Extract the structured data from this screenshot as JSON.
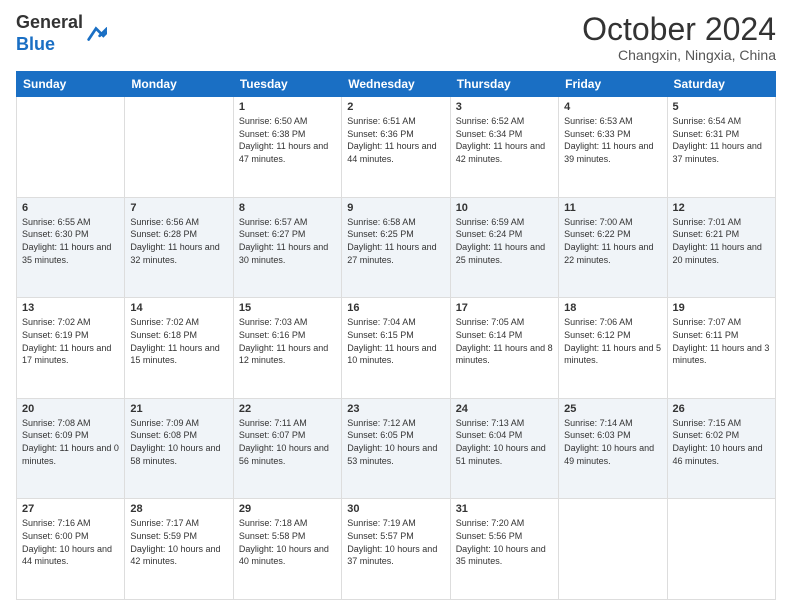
{
  "header": {
    "logo": {
      "line1": "General",
      "line2": "Blue"
    },
    "title": "October 2024",
    "location": "Changxin, Ningxia, China"
  },
  "days_of_week": [
    "Sunday",
    "Monday",
    "Tuesday",
    "Wednesday",
    "Thursday",
    "Friday",
    "Saturday"
  ],
  "weeks": [
    [
      {
        "day": "",
        "info": ""
      },
      {
        "day": "",
        "info": ""
      },
      {
        "day": "1",
        "info": "Sunrise: 6:50 AM\nSunset: 6:38 PM\nDaylight: 11 hours and 47 minutes."
      },
      {
        "day": "2",
        "info": "Sunrise: 6:51 AM\nSunset: 6:36 PM\nDaylight: 11 hours and 44 minutes."
      },
      {
        "day": "3",
        "info": "Sunrise: 6:52 AM\nSunset: 6:34 PM\nDaylight: 11 hours and 42 minutes."
      },
      {
        "day": "4",
        "info": "Sunrise: 6:53 AM\nSunset: 6:33 PM\nDaylight: 11 hours and 39 minutes."
      },
      {
        "day": "5",
        "info": "Sunrise: 6:54 AM\nSunset: 6:31 PM\nDaylight: 11 hours and 37 minutes."
      }
    ],
    [
      {
        "day": "6",
        "info": "Sunrise: 6:55 AM\nSunset: 6:30 PM\nDaylight: 11 hours and 35 minutes."
      },
      {
        "day": "7",
        "info": "Sunrise: 6:56 AM\nSunset: 6:28 PM\nDaylight: 11 hours and 32 minutes."
      },
      {
        "day": "8",
        "info": "Sunrise: 6:57 AM\nSunset: 6:27 PM\nDaylight: 11 hours and 30 minutes."
      },
      {
        "day": "9",
        "info": "Sunrise: 6:58 AM\nSunset: 6:25 PM\nDaylight: 11 hours and 27 minutes."
      },
      {
        "day": "10",
        "info": "Sunrise: 6:59 AM\nSunset: 6:24 PM\nDaylight: 11 hours and 25 minutes."
      },
      {
        "day": "11",
        "info": "Sunrise: 7:00 AM\nSunset: 6:22 PM\nDaylight: 11 hours and 22 minutes."
      },
      {
        "day": "12",
        "info": "Sunrise: 7:01 AM\nSunset: 6:21 PM\nDaylight: 11 hours and 20 minutes."
      }
    ],
    [
      {
        "day": "13",
        "info": "Sunrise: 7:02 AM\nSunset: 6:19 PM\nDaylight: 11 hours and 17 minutes."
      },
      {
        "day": "14",
        "info": "Sunrise: 7:02 AM\nSunset: 6:18 PM\nDaylight: 11 hours and 15 minutes."
      },
      {
        "day": "15",
        "info": "Sunrise: 7:03 AM\nSunset: 6:16 PM\nDaylight: 11 hours and 12 minutes."
      },
      {
        "day": "16",
        "info": "Sunrise: 7:04 AM\nSunset: 6:15 PM\nDaylight: 11 hours and 10 minutes."
      },
      {
        "day": "17",
        "info": "Sunrise: 7:05 AM\nSunset: 6:14 PM\nDaylight: 11 hours and 8 minutes."
      },
      {
        "day": "18",
        "info": "Sunrise: 7:06 AM\nSunset: 6:12 PM\nDaylight: 11 hours and 5 minutes."
      },
      {
        "day": "19",
        "info": "Sunrise: 7:07 AM\nSunset: 6:11 PM\nDaylight: 11 hours and 3 minutes."
      }
    ],
    [
      {
        "day": "20",
        "info": "Sunrise: 7:08 AM\nSunset: 6:09 PM\nDaylight: 11 hours and 0 minutes."
      },
      {
        "day": "21",
        "info": "Sunrise: 7:09 AM\nSunset: 6:08 PM\nDaylight: 10 hours and 58 minutes."
      },
      {
        "day": "22",
        "info": "Sunrise: 7:11 AM\nSunset: 6:07 PM\nDaylight: 10 hours and 56 minutes."
      },
      {
        "day": "23",
        "info": "Sunrise: 7:12 AM\nSunset: 6:05 PM\nDaylight: 10 hours and 53 minutes."
      },
      {
        "day": "24",
        "info": "Sunrise: 7:13 AM\nSunset: 6:04 PM\nDaylight: 10 hours and 51 minutes."
      },
      {
        "day": "25",
        "info": "Sunrise: 7:14 AM\nSunset: 6:03 PM\nDaylight: 10 hours and 49 minutes."
      },
      {
        "day": "26",
        "info": "Sunrise: 7:15 AM\nSunset: 6:02 PM\nDaylight: 10 hours and 46 minutes."
      }
    ],
    [
      {
        "day": "27",
        "info": "Sunrise: 7:16 AM\nSunset: 6:00 PM\nDaylight: 10 hours and 44 minutes."
      },
      {
        "day": "28",
        "info": "Sunrise: 7:17 AM\nSunset: 5:59 PM\nDaylight: 10 hours and 42 minutes."
      },
      {
        "day": "29",
        "info": "Sunrise: 7:18 AM\nSunset: 5:58 PM\nDaylight: 10 hours and 40 minutes."
      },
      {
        "day": "30",
        "info": "Sunrise: 7:19 AM\nSunset: 5:57 PM\nDaylight: 10 hours and 37 minutes."
      },
      {
        "day": "31",
        "info": "Sunrise: 7:20 AM\nSunset: 5:56 PM\nDaylight: 10 hours and 35 minutes."
      },
      {
        "day": "",
        "info": ""
      },
      {
        "day": "",
        "info": ""
      }
    ]
  ]
}
